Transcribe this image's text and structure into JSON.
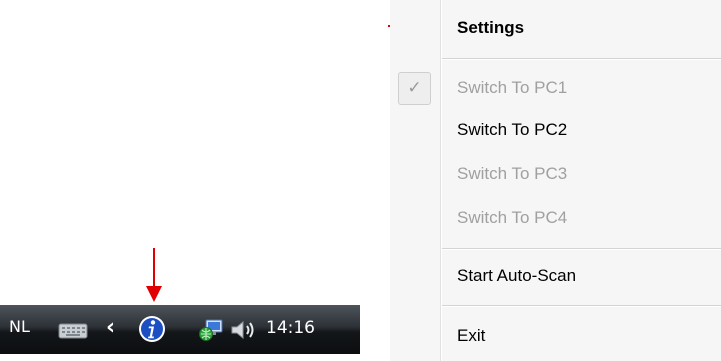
{
  "taskbar": {
    "language": "NL",
    "clock": "14:16",
    "chevron": "‹",
    "icons": [
      "keyboard-icon",
      "info-icon",
      "network-icon",
      "speaker-icon"
    ]
  },
  "menu": {
    "items": [
      {
        "label": "Settings",
        "bold": true,
        "enabled": true
      },
      {
        "label": "Switch To PC1",
        "enabled": false,
        "checked": true
      },
      {
        "label": "Switch To PC2",
        "enabled": true
      },
      {
        "label": "Switch To PC3",
        "enabled": false
      },
      {
        "label": "Switch To PC4",
        "enabled": false
      },
      {
        "label": "Start Auto-Scan",
        "enabled": true
      },
      {
        "label": "Exit",
        "enabled": true
      }
    ],
    "check_glyph": "✓"
  },
  "colors": {
    "annotation_arrow": "#e00000",
    "menu_background": "#f6f6f6",
    "disabled_text": "#a0a0a0"
  }
}
